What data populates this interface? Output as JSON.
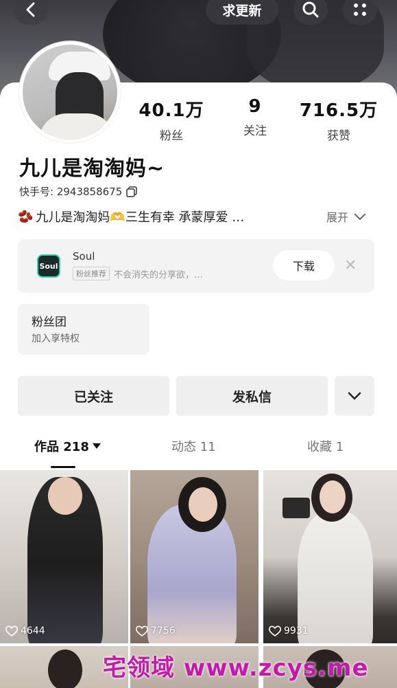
{
  "header": {
    "update_label": "求更新"
  },
  "stats": [
    {
      "value": "40.1万",
      "label": "粉丝"
    },
    {
      "value": "9",
      "label": "关注"
    },
    {
      "value": "716.5万",
      "label": "获赞"
    }
  ],
  "profile": {
    "name": "九儿是淘淘妈~",
    "kuaishou_id": "快手号: 2943858675",
    "bio": "九儿是淘淘妈🫶三生有幸 承蒙厚爱 …",
    "bio_emoji": "🫘",
    "expand_label": "展开"
  },
  "ad": {
    "logo_text": "Soul",
    "app_name": "Soul",
    "tag": "粉丝推荐",
    "desc": "不会消失的分享欲，…",
    "download_label": "下载"
  },
  "fan_group": {
    "title": "粉丝团",
    "subtitle": "加入享特权"
  },
  "actions": {
    "follow_label": "已关注",
    "message_label": "发私信"
  },
  "tabs": [
    {
      "label": "作品 218",
      "active": true
    },
    {
      "label": "动态 11",
      "active": false
    },
    {
      "label": "收藏 1",
      "active": false
    }
  ],
  "grid": [
    {
      "likes": "4644"
    },
    {
      "likes": "7756"
    },
    {
      "likes": "9931"
    }
  ],
  "watermark": "宅领域 www.zcys.me"
}
